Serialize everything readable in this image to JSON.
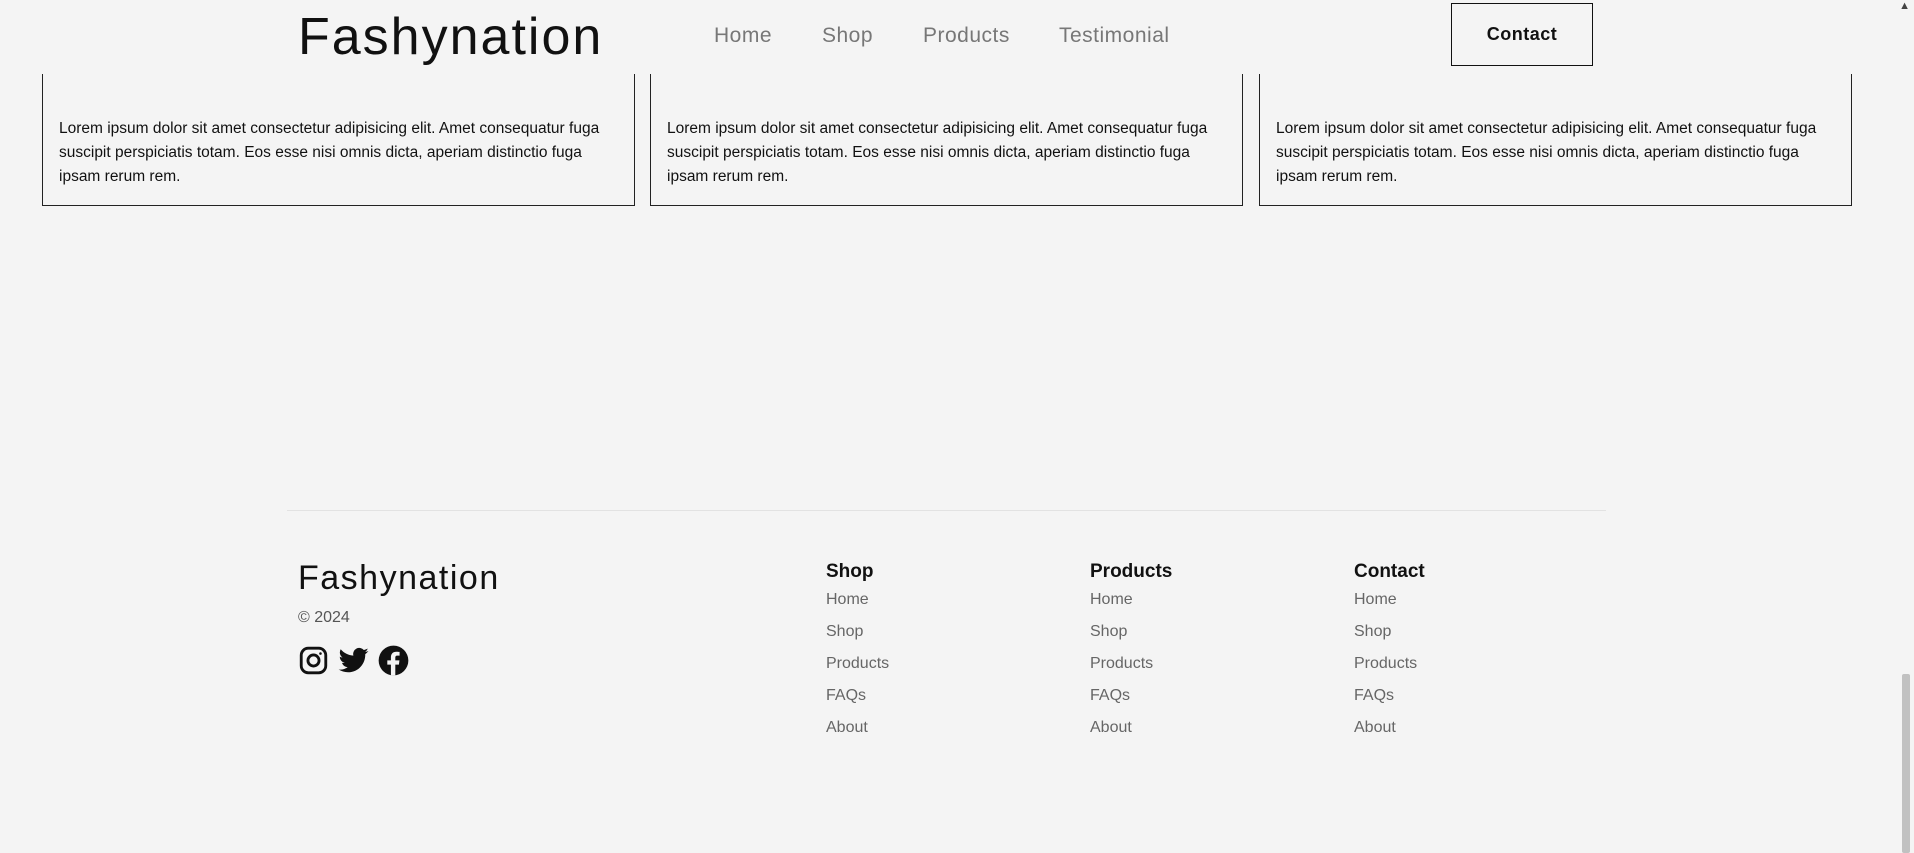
{
  "header": {
    "brand": "Fashynation",
    "nav": [
      {
        "label": "Home"
      },
      {
        "label": "Shop"
      },
      {
        "label": "Products"
      },
      {
        "label": "Testimonial"
      }
    ],
    "contact_label": "Contact"
  },
  "cards": [
    {
      "text": "Lorem ipsum dolor sit amet consectetur adipisicing elit. Amet consequatur fuga suscipit perspiciatis totam. Eos esse nisi omnis dicta, aperiam distinctio fuga ipsam rerum rem."
    },
    {
      "text": "Lorem ipsum dolor sit amet consectetur adipisicing elit. Amet consequatur fuga suscipit perspiciatis totam. Eos esse nisi omnis dicta, aperiam distinctio fuga ipsam rerum rem."
    },
    {
      "text": "Lorem ipsum dolor sit amet consectetur adipisicing elit. Amet consequatur fuga suscipit perspiciatis totam. Eos esse nisi omnis dicta, aperiam distinctio fuga ipsam rerum rem."
    }
  ],
  "footer": {
    "brand": "Fashynation",
    "copyright": "© 2024",
    "social_icons": [
      "instagram-icon",
      "twitter-icon",
      "facebook-icon"
    ],
    "columns": [
      {
        "title": "Shop",
        "links": [
          "Home",
          "Shop",
          "Products",
          "FAQs",
          "About"
        ]
      },
      {
        "title": "Products",
        "links": [
          "Home",
          "Shop",
          "Products",
          "FAQs",
          "About"
        ]
      },
      {
        "title": "Contact",
        "links": [
          "Home",
          "Shop",
          "Products",
          "FAQs",
          "About"
        ]
      }
    ]
  },
  "colors": {
    "background": "#f4f4f4",
    "text": "#111111",
    "muted": "#777777",
    "border": "#222222"
  }
}
